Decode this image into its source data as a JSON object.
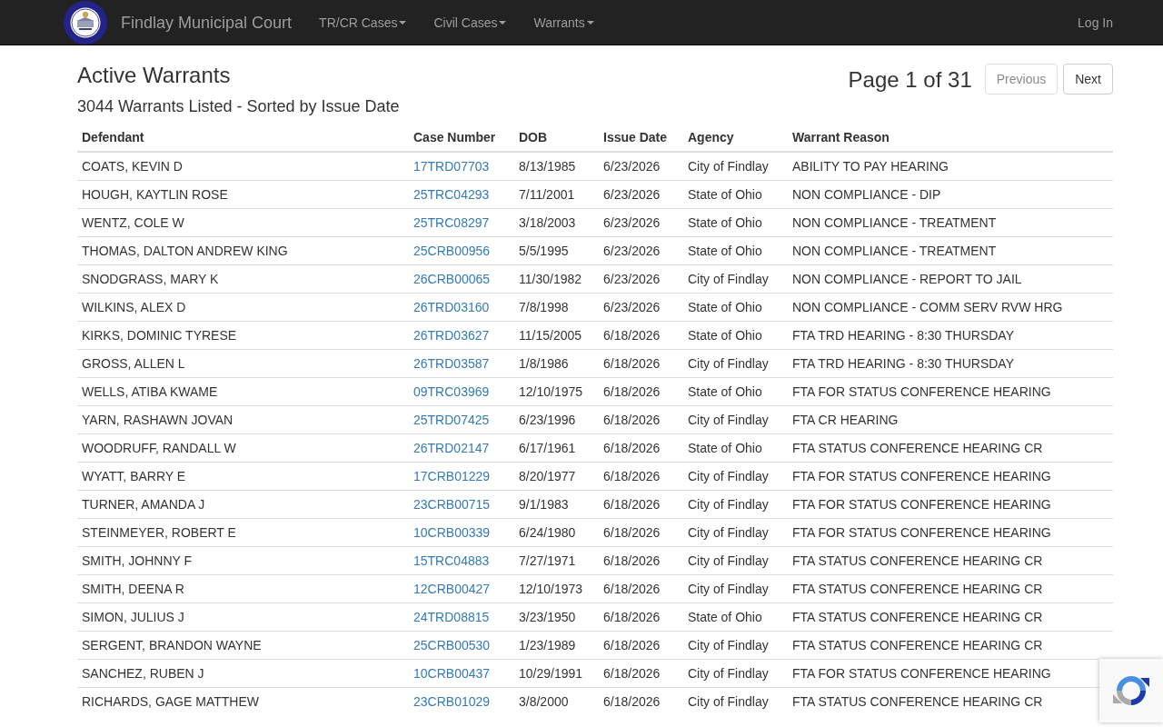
{
  "navbar": {
    "brand": "Findlay Municipal Court",
    "menus": [
      {
        "label": "TR/CR Cases",
        "dropdown": true
      },
      {
        "label": "Civil Cases",
        "dropdown": true
      },
      {
        "label": "Warrants",
        "dropdown": true
      }
    ],
    "login": "Log In"
  },
  "header": {
    "title": "Active Warrants",
    "subtitle": "3044 Warrants Listed - Sorted by Issue Date",
    "page_info": "Page 1 of 31",
    "buttons": [
      {
        "label": "Previous",
        "disabled": true
      },
      {
        "label": "Next",
        "disabled": false
      }
    ]
  },
  "table": {
    "columns": [
      "Defendant",
      "Case Number",
      "DOB",
      "Issue Date",
      "Agency",
      "Warrant Reason"
    ],
    "rows": [
      {
        "defendant": "COATS, KEVIN D",
        "case_number": "17TRD07703",
        "dob": "8/13/1985",
        "issue_date": "6/23/2026",
        "agency": "City of Findlay",
        "warrant_reason": "ABILITY TO PAY HEARING"
      },
      {
        "defendant": "HOUGH, KAYTLIN ROSE",
        "case_number": "25TRC04293",
        "dob": "7/11/2001",
        "issue_date": "6/23/2026",
        "agency": "State of Ohio",
        "warrant_reason": "NON COMPLIANCE - DIP"
      },
      {
        "defendant": "WENTZ, COLE W",
        "case_number": "25TRC08297",
        "dob": "3/18/2003",
        "issue_date": "6/23/2026",
        "agency": "State of Ohio",
        "warrant_reason": "NON COMPLIANCE - TREATMENT"
      },
      {
        "defendant": "THOMAS, DALTON ANDREW KING",
        "case_number": "25CRB00956",
        "dob": "5/5/1995",
        "issue_date": "6/23/2026",
        "agency": "State of Ohio",
        "warrant_reason": "NON COMPLIANCE - TREATMENT"
      },
      {
        "defendant": "SNODGRASS, MARY K",
        "case_number": "26CRB00065",
        "dob": "11/30/1982",
        "issue_date": "6/23/2026",
        "agency": "City of Findlay",
        "warrant_reason": "NON COMPLIANCE - REPORT TO JAIL"
      },
      {
        "defendant": "WILKINS, ALEX D",
        "case_number": "26TRD03160",
        "dob": "7/8/1998",
        "issue_date": "6/23/2026",
        "agency": "State of Ohio",
        "warrant_reason": "NON COMPLIANCE - COMM SERV RVW HRG"
      },
      {
        "defendant": "KIRKS, DOMINIC TYRESE",
        "case_number": "26TRD03627",
        "dob": "11/15/2005",
        "issue_date": "6/18/2026",
        "agency": "State of Ohio",
        "warrant_reason": "FTA TRD HEARING - 8:30 THURSDAY"
      },
      {
        "defendant": "GROSS, ALLEN L",
        "case_number": "26TRD03587",
        "dob": "1/8/1986",
        "issue_date": "6/18/2026",
        "agency": "City of Findlay",
        "warrant_reason": "FTA TRD HEARING - 8:30 THURSDAY"
      },
      {
        "defendant": "WELLS, ATIBA KWAME",
        "case_number": "09TRC03969",
        "dob": "12/10/1975",
        "issue_date": "6/18/2026",
        "agency": "State of Ohio",
        "warrant_reason": "FTA FOR STATUS CONFERENCE HEARING"
      },
      {
        "defendant": "YARN, RASHAWN JOVAN",
        "case_number": "25TRD07425",
        "dob": "6/23/1996",
        "issue_date": "6/18/2026",
        "agency": "City of Findlay",
        "warrant_reason": "FTA CR HEARING"
      },
      {
        "defendant": "WOODRUFF, RANDALL W",
        "case_number": "26TRD02147",
        "dob": "6/17/1961",
        "issue_date": "6/18/2026",
        "agency": "State of Ohio",
        "warrant_reason": "FTA STATUS CONFERENCE HEARING CR"
      },
      {
        "defendant": "WYATT, BARRY E",
        "case_number": "17CRB01229",
        "dob": "8/20/1977",
        "issue_date": "6/18/2026",
        "agency": "City of Findlay",
        "warrant_reason": "FTA FOR STATUS CONFERENCE HEARING"
      },
      {
        "defendant": "TURNER, AMANDA J",
        "case_number": "23CRB00715",
        "dob": "9/1/1983",
        "issue_date": "6/18/2026",
        "agency": "City of Findlay",
        "warrant_reason": "FTA FOR STATUS CONFERENCE HEARING"
      },
      {
        "defendant": "STEINMEYER, ROBERT E",
        "case_number": "10CRB00339",
        "dob": "6/24/1980",
        "issue_date": "6/18/2026",
        "agency": "City of Findlay",
        "warrant_reason": "FTA FOR STATUS CONFERENCE HEARING"
      },
      {
        "defendant": "SMITH, JOHNNY F",
        "case_number": "15TRC04883",
        "dob": "7/27/1971",
        "issue_date": "6/18/2026",
        "agency": "City of Findlay",
        "warrant_reason": "FTA STATUS CONFERENCE HEARING CR"
      },
      {
        "defendant": "SMITH, DEENA R",
        "case_number": "12CRB00427",
        "dob": "12/10/1973",
        "issue_date": "6/18/2026",
        "agency": "City of Findlay",
        "warrant_reason": "FTA STATUS CONFERENCE HEARING CR"
      },
      {
        "defendant": "SIMON, JULIUS J",
        "case_number": "24TRD08815",
        "dob": "3/23/1950",
        "issue_date": "6/18/2026",
        "agency": "State of Ohio",
        "warrant_reason": "FTA STATUS CONFERENCE HEARING CR"
      },
      {
        "defendant": "SERGENT, BRANDON WAYNE",
        "case_number": "25CRB00530",
        "dob": "1/23/1989",
        "issue_date": "6/18/2026",
        "agency": "City of Findlay",
        "warrant_reason": "FTA STATUS CONFERENCE HEARING CR"
      },
      {
        "defendant": "SANCHEZ, RUBEN J",
        "case_number": "10CRB00437",
        "dob": "10/29/1991",
        "issue_date": "6/18/2026",
        "agency": "City of Findlay",
        "warrant_reason": "FTA FOR STATUS CONFERENCE HEARING"
      },
      {
        "defendant": "RICHARDS, GAGE MATTHEW",
        "case_number": "23CRB01029",
        "dob": "3/8/2000",
        "issue_date": "6/18/2026",
        "agency": "City of Findlay",
        "warrant_reason": "FTA STATUS CONFERENCE HEARING CR"
      }
    ]
  }
}
